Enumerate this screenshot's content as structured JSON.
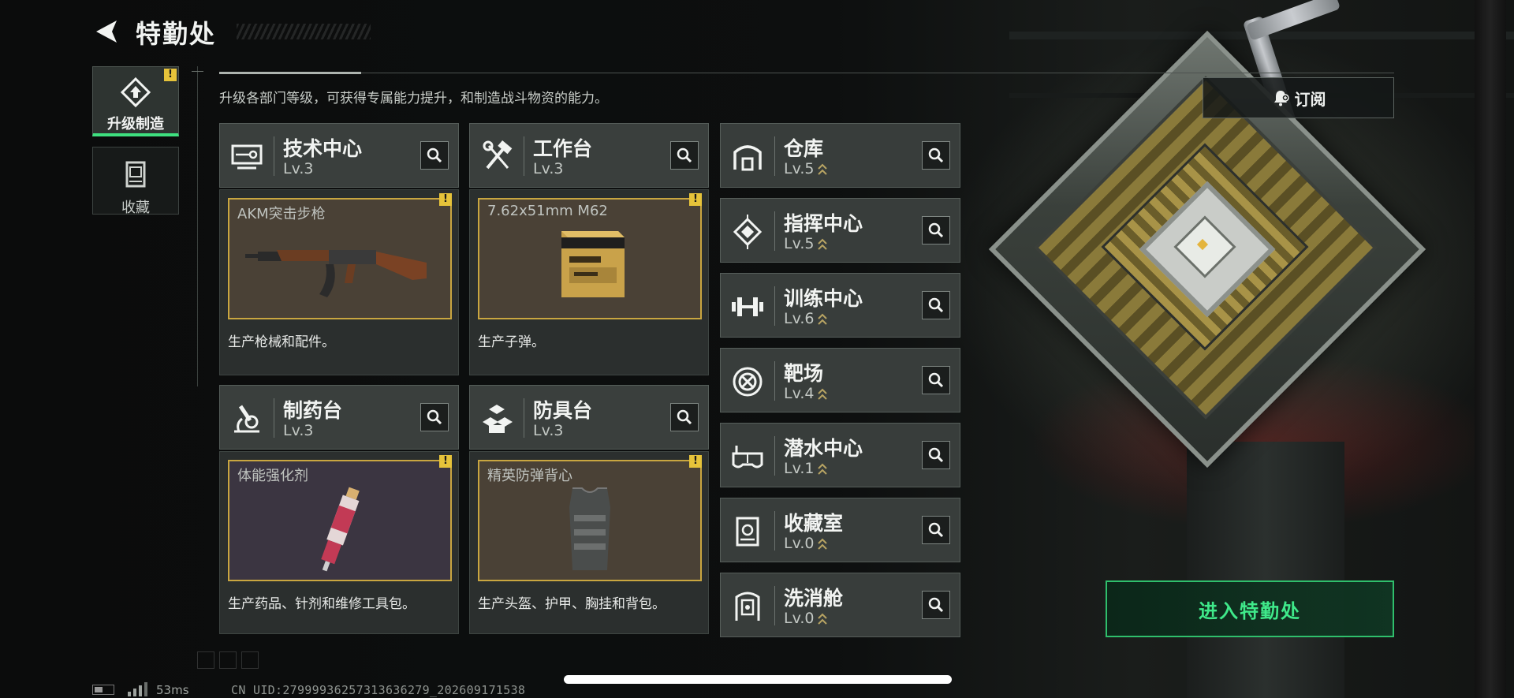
{
  "header": {
    "title": "特勤处",
    "subtitle": "升级各部门等级，可获得专属能力提升，和制造战斗物资的能力。"
  },
  "tabs": [
    {
      "label": "升级制造",
      "warning": "!"
    },
    {
      "label": "收藏"
    }
  ],
  "subscribe": {
    "label": "订阅"
  },
  "facilities": [
    {
      "name": "技术中心",
      "level": "Lv.3",
      "product": "AKM突击步枪",
      "warning": "!",
      "desc": "生产枪械和配件。"
    },
    {
      "name": "工作台",
      "level": "Lv.3",
      "product": "7.62x51mm M62",
      "warning": "!",
      "desc": "生产子弹。"
    },
    {
      "name": "制药台",
      "level": "Lv.3",
      "product": "体能强化剂",
      "warning": "!",
      "desc": "生产药品、针剂和维修工具包。"
    },
    {
      "name": "防具台",
      "level": "Lv.3",
      "product": "精英防弹背心",
      "warning": "!",
      "desc": "生产头盔、护甲、胸挂和背包。"
    }
  ],
  "rooms": [
    {
      "name": "仓库",
      "level": "Lv.5"
    },
    {
      "name": "指挥中心",
      "level": "Lv.5"
    },
    {
      "name": "训练中心",
      "level": "Lv.6"
    },
    {
      "name": "靶场",
      "level": "Lv.4"
    },
    {
      "name": "潜水中心",
      "level": "Lv.1"
    },
    {
      "name": "收藏室",
      "level": "Lv.0"
    },
    {
      "name": "洗消舱",
      "level": "Lv.0"
    }
  ],
  "enter_button": {
    "label": "进入特勤处"
  },
  "status": {
    "ping": "53ms",
    "uid": "CN UID:279999362573136362​79_202609171538"
  },
  "colors": {
    "accent_green": "#3ee07f",
    "warning_yellow": "#e6c33a",
    "product_border": "#c9a640"
  }
}
